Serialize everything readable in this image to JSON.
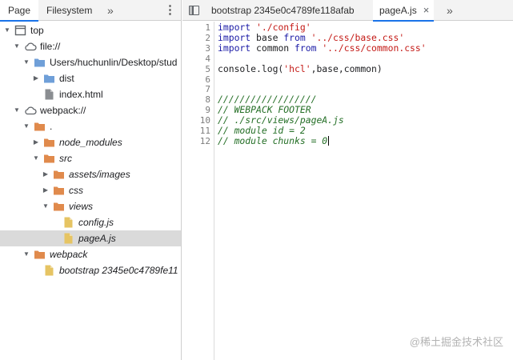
{
  "nav": {
    "tabs": [
      "Page",
      "Filesystem"
    ],
    "more_icon": "double-chevron-right",
    "menu_icon": "kebab-menu"
  },
  "tree": [
    {
      "label": "top",
      "icon": "frame-icon",
      "expanded": true,
      "indent": 0
    },
    {
      "label": "file://",
      "icon": "cloud-icon",
      "expanded": true,
      "indent": 1
    },
    {
      "label": "Users/huchunlin/Desktop/stud",
      "icon": "folder-blue-icon",
      "expanded": true,
      "indent": 2
    },
    {
      "label": "dist",
      "icon": "folder-blue-icon",
      "expanded": false,
      "indent": 3
    },
    {
      "label": "index.html",
      "icon": "file-gray-icon",
      "indent": 3
    },
    {
      "label": "webpack://",
      "icon": "cloud-icon",
      "expanded": true,
      "indent": 1
    },
    {
      "label": ".",
      "icon": "folder-orange-icon",
      "expanded": true,
      "indent": 2
    },
    {
      "label": "node_modules",
      "icon": "folder-orange-icon",
      "expanded": false,
      "indent": 3,
      "italic": true
    },
    {
      "label": "src",
      "icon": "folder-orange-icon",
      "expanded": true,
      "indent": 3,
      "italic": true
    },
    {
      "label": "assets/images",
      "icon": "folder-orange-icon",
      "expanded": false,
      "indent": 4,
      "italic": true
    },
    {
      "label": "css",
      "icon": "folder-orange-icon",
      "expanded": false,
      "indent": 4,
      "italic": true
    },
    {
      "label": "views",
      "icon": "folder-orange-icon",
      "expanded": true,
      "indent": 4,
      "italic": true
    },
    {
      "label": "config.js",
      "icon": "file-yellow-icon",
      "indent": 5,
      "italic": true
    },
    {
      "label": "pageA.js",
      "icon": "file-yellow-icon",
      "indent": 5,
      "italic": true,
      "selected": true
    },
    {
      "label": "webpack",
      "icon": "folder-orange-icon",
      "expanded": true,
      "indent": 2,
      "italic": true
    },
    {
      "label": "bootstrap 2345e0c4789fe11",
      "icon": "file-yellow-icon",
      "indent": 3,
      "italic": true
    }
  ],
  "editor": {
    "tabs": [
      {
        "label": "bootstrap 2345e0c4789fe118afab",
        "active": false
      },
      {
        "label": "pageA.js",
        "active": true,
        "close": "×"
      }
    ],
    "more_icon": "double-chevron-right",
    "toggle_icon": "sidebar-toggle",
    "lines": [
      [
        {
          "t": "import",
          "c": "kw"
        },
        {
          "t": " "
        },
        {
          "t": "'./config'",
          "c": "str"
        }
      ],
      [
        {
          "t": "import",
          "c": "kw"
        },
        {
          "t": " base "
        },
        {
          "t": "from",
          "c": "kw"
        },
        {
          "t": " "
        },
        {
          "t": "'../css/base.css'",
          "c": "str"
        }
      ],
      [
        {
          "t": "import",
          "c": "kw"
        },
        {
          "t": " common "
        },
        {
          "t": "from",
          "c": "kw"
        },
        {
          "t": " "
        },
        {
          "t": "'../css/common.css'",
          "c": "str"
        }
      ],
      [],
      [
        {
          "t": "console.log("
        },
        {
          "t": "'hcl'",
          "c": "str"
        },
        {
          "t": ",base,common)"
        }
      ],
      [],
      [],
      [
        {
          "t": "//////////////////",
          "c": "cm"
        }
      ],
      [
        {
          "t": "// WEBPACK FOOTER",
          "c": "cm"
        }
      ],
      [
        {
          "t": "// ./src/views/pageA.js",
          "c": "cm"
        }
      ],
      [
        {
          "t": "// module id = 2",
          "c": "cm"
        }
      ],
      [
        {
          "t": "// module chunks = 0",
          "c": "cm"
        }
      ]
    ]
  },
  "watermark": "@稀土掘金技术社区",
  "colors": {
    "accent": "#1a73e8",
    "folder_orange": "#e08a4c",
    "folder_blue": "#6f9fd8",
    "file_yellow": "#e6c463",
    "file_gray": "#8a8d91",
    "keyword": "#1a1aa6",
    "string": "#c41a16",
    "comment": "#236e25",
    "selection": "#dadada"
  }
}
